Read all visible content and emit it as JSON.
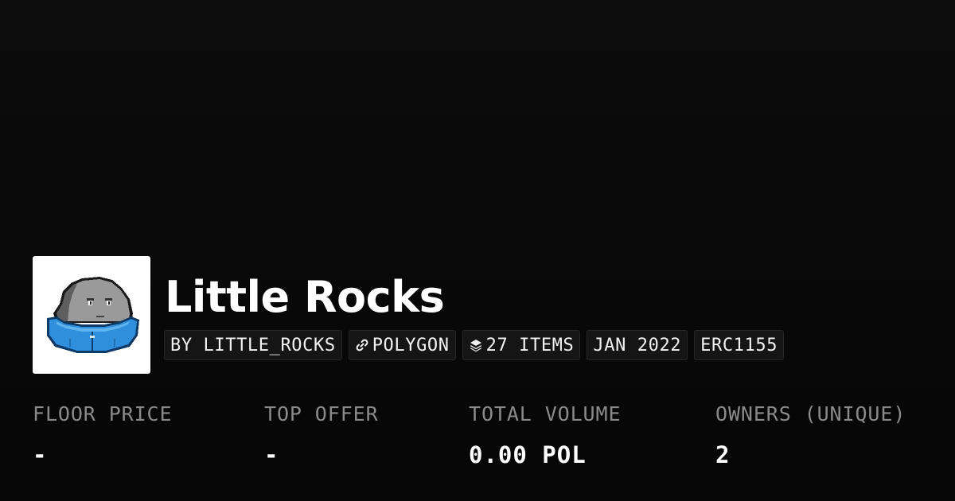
{
  "collection": {
    "name": "Little Rocks",
    "avatar_icon": "pixel-rock-in-blue-jacket-icon"
  },
  "chips": {
    "creator": "BY LITTLE_ROCKS",
    "chain": "POLYGON",
    "chain_icon": "link-icon",
    "items": "27 ITEMS",
    "items_icon": "layers-icon",
    "date": "JAN 2022",
    "standard": "ERC1155"
  },
  "stats": {
    "floor_price": {
      "label": "FLOOR PRICE",
      "value": "-"
    },
    "top_offer": {
      "label": "TOP OFFER",
      "value": "-"
    },
    "total_volume": {
      "label": "TOTAL VOLUME",
      "value": "0.00 POL"
    },
    "owners": {
      "label": "OWNERS (UNIQUE)",
      "value": "2"
    }
  },
  "colors": {
    "background": "#0a0a0a",
    "chip_background": "#151515",
    "label_gray": "#8a8a8a",
    "avatar_jacket_blue": "#2f8fdc",
    "avatar_rock_gray": "#9a9a9a"
  }
}
